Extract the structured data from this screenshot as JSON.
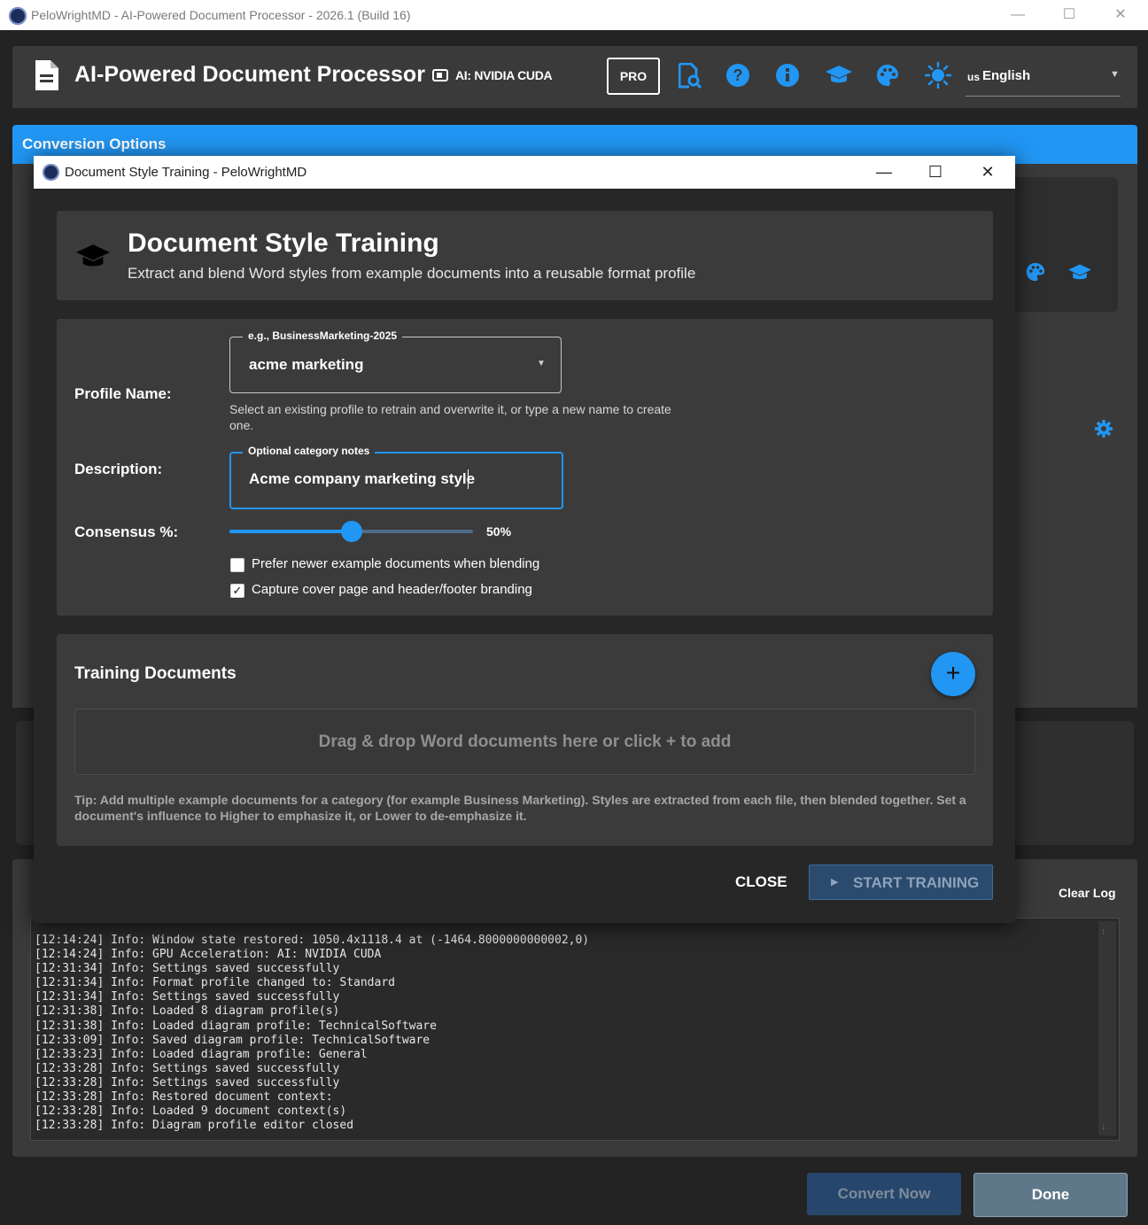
{
  "window": {
    "title": "PeloWrightMD - AI-Powered Document Processor - 2026.1 (Build 16)",
    "controls": {
      "minimize": "—",
      "maximize": "☐",
      "close": "✕"
    }
  },
  "header": {
    "title": "AI-Powered Document Processor",
    "ai_label": "AI: NVIDIA CUDA",
    "pro_label": "PRO",
    "language": {
      "flag": "us",
      "label": "English"
    }
  },
  "conversion": {
    "title": "Conversion Options"
  },
  "log": {
    "clear_label": "Clear Log",
    "lines": [
      "[12:14:24] Info: Window state restored: 1050.4x1118.4 at (-1464.8000000000002,0)",
      "[12:14:24] Info: GPU Acceleration: AI: NVIDIA CUDA",
      "[12:31:34] Info: Settings saved successfully",
      "[12:31:34] Info: Format profile changed to: Standard",
      "[12:31:34] Info: Settings saved successfully",
      "[12:31:38] Info: Loaded 8 diagram profile(s)",
      "[12:31:38] Info: Loaded diagram profile: TechnicalSoftware",
      "[12:33:09] Info: Saved diagram profile: TechnicalSoftware",
      "[12:33:23] Info: Loaded diagram profile: General",
      "[12:33:28] Info: Settings saved successfully",
      "[12:33:28] Info: Settings saved successfully",
      "[12:33:28] Info: Restored document context:",
      "[12:33:28] Info: Loaded 9 document context(s)",
      "[12:33:28] Info: Diagram profile editor closed"
    ]
  },
  "footer": {
    "convert_label": "Convert Now",
    "done_label": "Done"
  },
  "dialog": {
    "title": "Document Style Training - PeloWrightMD",
    "heading": "Document Style Training",
    "subheading": "Extract and blend Word styles from example documents into a reusable format profile",
    "profile": {
      "label": "Profile Name:",
      "legend": "e.g., BusinessMarketing-2025",
      "value": "acme marketing",
      "helper": "Select an existing profile to retrain and overwrite it, or type a new name to create one."
    },
    "description": {
      "label": "Description:",
      "legend": "Optional category notes",
      "value": "Acme company marketing style"
    },
    "consensus": {
      "label": "Consensus %:",
      "value": 50,
      "value_label": "50%"
    },
    "options": [
      {
        "label": "Prefer newer example documents when blending",
        "checked": false
      },
      {
        "label": "Capture cover page and header/footer branding",
        "checked": true
      }
    ],
    "training": {
      "title": "Training Documents",
      "add_label": "+",
      "drop_text": "Drag & drop Word documents here or click + to add",
      "tip": "Tip:  Add multiple example documents for a category (for example Business Marketing). Styles are extracted from each file, then blended together. Set a document's influence to Higher to emphasize it, or Lower to de-emphasize it."
    },
    "close_label": "CLOSE",
    "start_label": "START TRAINING"
  },
  "colors": {
    "accent": "#2196f3",
    "background": "#232323",
    "card": "#3b3b3b"
  }
}
